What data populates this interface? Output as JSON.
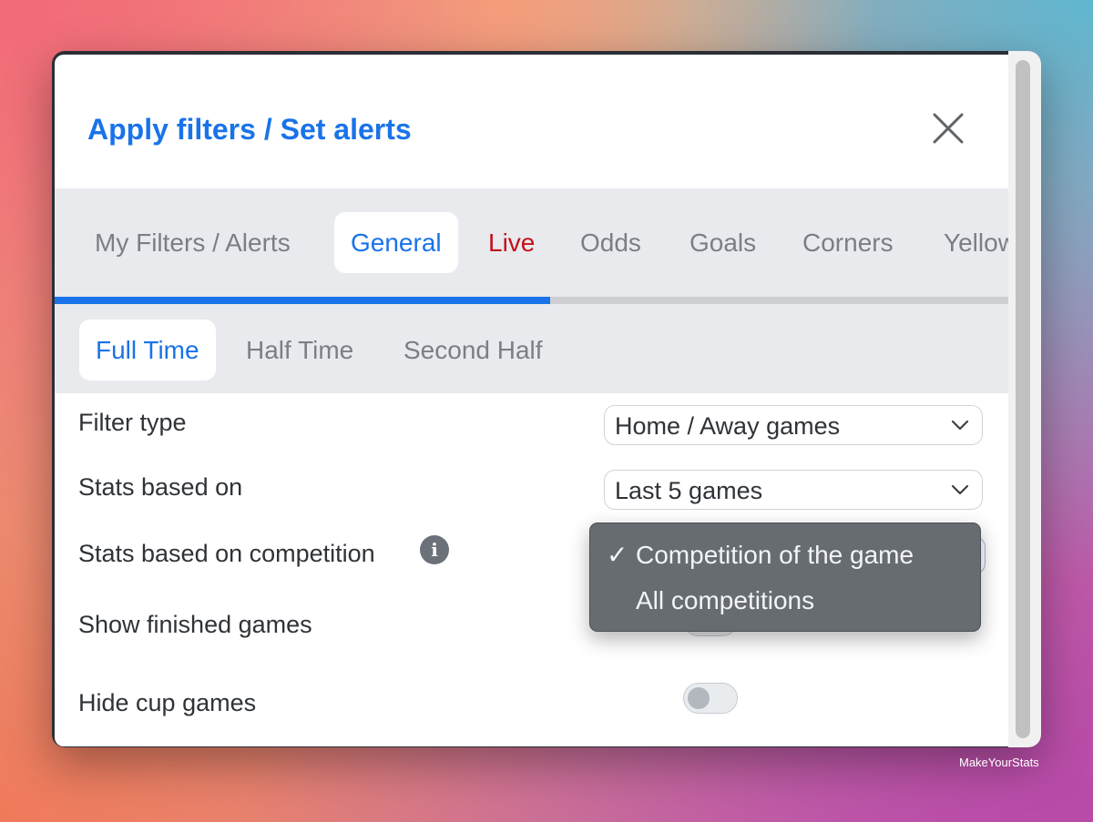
{
  "modal": {
    "title": "Apply filters / Set alerts",
    "close_icon": "close-icon"
  },
  "tabs": [
    {
      "label": "My Filters / Alerts",
      "state": "inactive"
    },
    {
      "label": "General",
      "state": "active"
    },
    {
      "label": "Live",
      "state": "highlighted-red"
    },
    {
      "label": "Odds",
      "state": "inactive"
    },
    {
      "label": "Goals",
      "state": "inactive"
    },
    {
      "label": "Corners",
      "state": "inactive"
    },
    {
      "label": "Yellow",
      "state": "inactive"
    }
  ],
  "tabs_progress": 0.52,
  "subtabs": [
    {
      "label": "Full Time",
      "state": "active"
    },
    {
      "label": "Half Time",
      "state": "inactive"
    },
    {
      "label": "Second Half",
      "state": "inactive"
    }
  ],
  "settings": {
    "filter_type": {
      "label": "Filter type",
      "value": "Home / Away games"
    },
    "stats_based_on": {
      "label": "Stats based on",
      "value": "Last 5 games"
    },
    "stats_competition": {
      "label": "Stats based on competition",
      "info_icon": "info-icon"
    },
    "show_finished": {
      "label": "Show finished games"
    },
    "hide_cup": {
      "label": "Hide cup games",
      "enabled": false
    }
  },
  "competition_dropdown": {
    "options": [
      {
        "label": "Competition of the game",
        "selected": true,
        "check": "✓"
      },
      {
        "label": "All competitions",
        "selected": false,
        "check": ""
      }
    ]
  },
  "colors": {
    "accent": "#1a73e8",
    "live": "#c5111a",
    "text": "#2f3338",
    "muted": "#7a7f86",
    "tabs_bg": "#e8eaed",
    "dropdown_bg": "#676c71"
  },
  "watermark": "MakeYourStats"
}
